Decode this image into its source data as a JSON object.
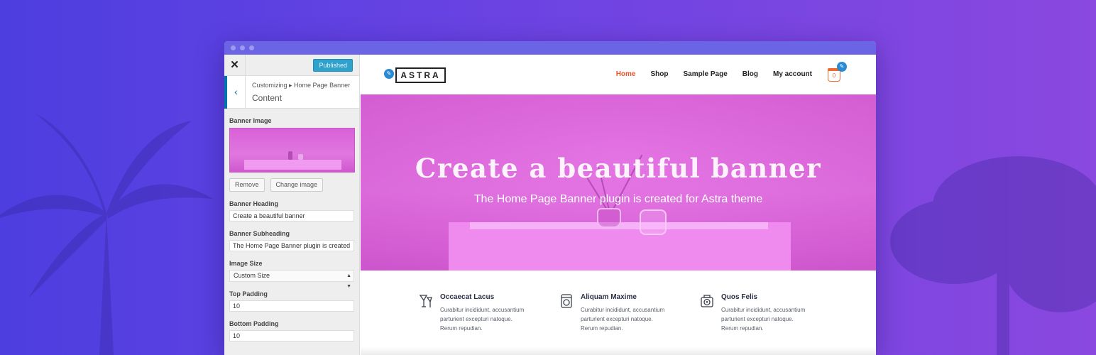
{
  "window": {
    "publish_label": "Published"
  },
  "sidebar": {
    "close_glyph": "✕",
    "back_glyph": "‹",
    "breadcrumb": "Customizing ▸ Home Page Banner",
    "section_title": "Content",
    "banner_image_label": "Banner Image",
    "remove_label": "Remove",
    "change_image_label": "Change image",
    "banner_heading_label": "Banner Heading",
    "banner_heading_value": "Create a beautiful banner",
    "banner_subheading_label": "Banner Subheading",
    "banner_subheading_value": "The Home Page Banner plugin is created",
    "image_size_label": "Image Size",
    "image_size_value": "Custom Size",
    "top_padding_label": "Top Padding",
    "top_padding_value": "10",
    "bottom_padding_label": "Bottom Padding",
    "bottom_padding_value": "10"
  },
  "site": {
    "logo_text": "ASTRA",
    "nav": [
      "Home",
      "Shop",
      "Sample Page",
      "Blog",
      "My account"
    ],
    "active_nav": "Home",
    "cart_count": "0",
    "accent_color": "#e8542b",
    "hero_title": "Create a beautiful banner",
    "hero_subtitle": "The Home Page Banner plugin is created for Astra theme",
    "features": [
      {
        "icon": "cocktail-icon",
        "title": "Occaecat Lacus",
        "text": "Curabitur incididunt, accusantium parturient excepturi natoque. Rerum repudian."
      },
      {
        "icon": "washing-machine-icon",
        "title": "Aliquam Maxime",
        "text": "Curabitur incididunt, accusantium parturient excepturi natoque. Rerum repudian."
      },
      {
        "icon": "camera-heart-icon",
        "title": "Quos Felis",
        "text": "Curabitur incididunt, accusantium parturient excepturi natoque. Rerum repudian."
      }
    ]
  }
}
